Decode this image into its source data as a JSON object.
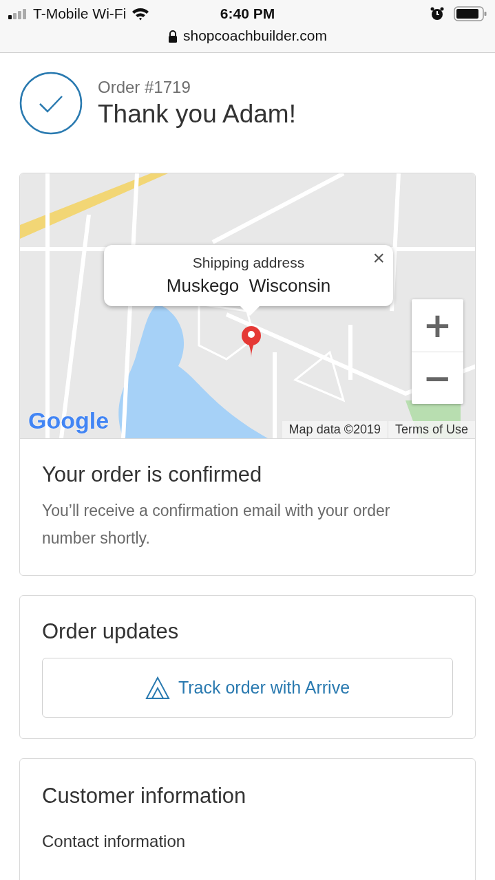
{
  "status_bar": {
    "carrier": "T-Mobile Wi-Fi",
    "time": "6:40 PM"
  },
  "address_bar": {
    "url": "shopcoachbuilder.com"
  },
  "header": {
    "order_number": "Order #1719",
    "greeting": "Thank you Adam!"
  },
  "map": {
    "kind": "picture",
    "popup": {
      "title": "Shipping address",
      "address": "Muskego  Wisconsin",
      "close": "×"
    },
    "zoom_in": "+",
    "zoom_out": "−",
    "logo": "Google",
    "attribution": "Map data ©2019",
    "terms": "Terms of Use"
  },
  "confirmation": {
    "title": "Your order is confirmed",
    "text": "You’ll receive a confirmation email with your order number shortly."
  },
  "updates": {
    "title": "Order updates",
    "button": "Track order with Arrive"
  },
  "customer": {
    "title": "Customer information",
    "subtitle": "Contact information"
  }
}
